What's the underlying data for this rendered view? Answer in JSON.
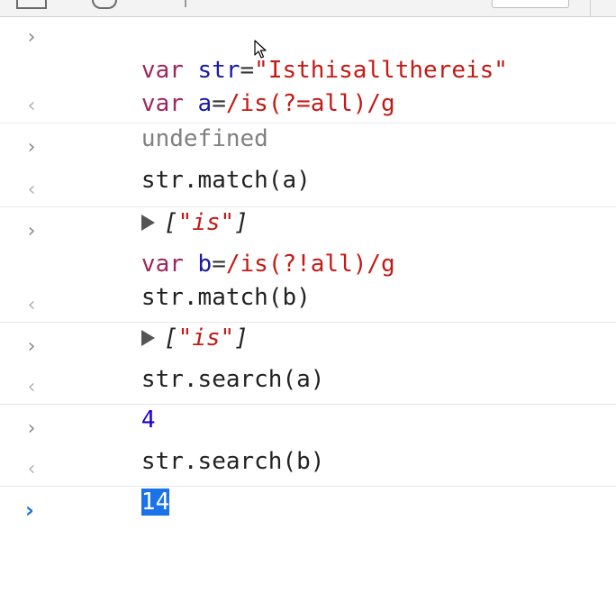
{
  "entries": [
    {
      "input": [
        {
          "kw": "var",
          "ident": "str",
          "op": "=",
          "val": "\"Isthisalltherеis\""
        },
        {
          "kw": "var",
          "ident": "a",
          "op": "=",
          "val": "/is(?=all)/g"
        }
      ],
      "output": "undefined"
    },
    {
      "input_plain": "str.match(a)",
      "output_array": "[\"is\"]",
      "output_prefix": "[",
      "output_string": "\"is\"",
      "output_suffix": "]"
    },
    {
      "input": [
        {
          "kw": "var",
          "ident": "b",
          "op": "=",
          "val": "/is(?!all)/g"
        }
      ],
      "input_plain2": "str.match(b)",
      "output_prefix": "[",
      "output_string": "\"is\"",
      "output_suffix": "]"
    },
    {
      "input_plain": "str.search(a)",
      "output": "4"
    },
    {
      "input_plain": "str.search(b)",
      "output": "14"
    }
  ],
  "icons": {
    "input_prompt": "chevron-right-icon",
    "output_marker": "chevron-left-icon",
    "expand": "triangle-right-icon",
    "active_prompt": "chevron-right-icon"
  },
  "glyphs": {
    "in": "›",
    "out": "‹",
    "prompt": "›"
  },
  "colors": {
    "keyword": "#a0265b",
    "identifier": "#1a1aa6",
    "string": "#c41a16",
    "number": "#1c00cf",
    "selection": "#1a73e8"
  }
}
